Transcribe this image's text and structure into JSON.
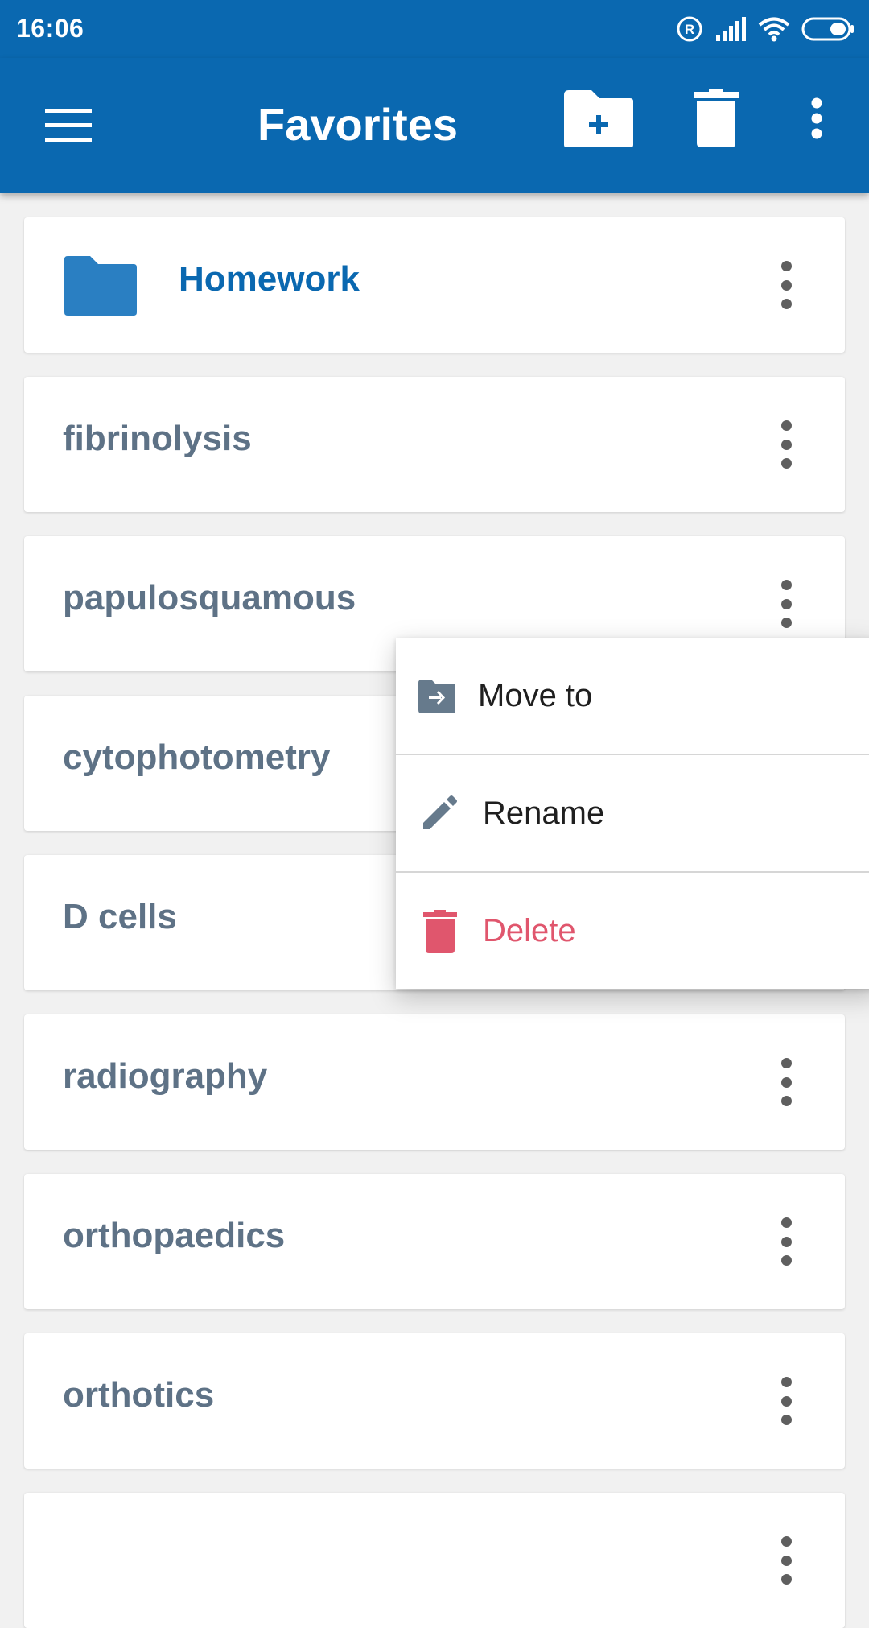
{
  "status": {
    "time": "16:06"
  },
  "appbar": {
    "title": "Favorites"
  },
  "items": [
    {
      "label": "Homework",
      "type": "folder"
    },
    {
      "label": "fibrinolysis",
      "type": "term"
    },
    {
      "label": "papulosquamous",
      "type": "term"
    },
    {
      "label": "cytophotometry",
      "type": "term"
    },
    {
      "label": "D cells",
      "type": "term"
    },
    {
      "label": "radiography",
      "type": "term"
    },
    {
      "label": "orthopaedics",
      "type": "term"
    },
    {
      "label": "orthotics",
      "type": "term"
    },
    {
      "label": "",
      "type": "term"
    }
  ],
  "context_menu": {
    "move_label": "Move to",
    "rename_label": "Rename",
    "delete_label": "Delete"
  },
  "colors": {
    "primary": "#0a68b0",
    "folder": "#2a7fc2",
    "term_text": "#5e7286",
    "danger": "#e0566d"
  }
}
